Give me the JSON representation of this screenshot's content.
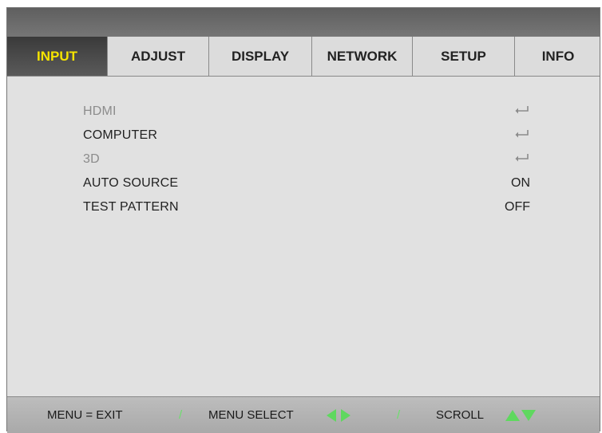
{
  "tabs": [
    {
      "label": "INPUT",
      "active": true
    },
    {
      "label": "ADJUST",
      "active": false
    },
    {
      "label": "DISPLAY",
      "active": false
    },
    {
      "label": "NETWORK",
      "active": false
    },
    {
      "label": "SETUP",
      "active": false
    },
    {
      "label": "INFO",
      "active": false
    }
  ],
  "menu": {
    "items": [
      {
        "label": "HDMI",
        "value_icon": "enter-icon",
        "enabled": false
      },
      {
        "label": "COMPUTER",
        "value_icon": "enter-icon",
        "enabled": true
      },
      {
        "label": "3D",
        "value_icon": "enter-icon",
        "enabled": false
      },
      {
        "label": "AUTO SOURCE",
        "value": "ON",
        "enabled": true
      },
      {
        "label": "TEST PATTERN",
        "value": "OFF",
        "enabled": true
      }
    ]
  },
  "footer": {
    "exit": "MENU = EXIT",
    "separator": "/",
    "select": "MENU SELECT",
    "scroll": "SCROLL"
  },
  "colors": {
    "active_tab_text": "#f5e400",
    "arrow_green": "#5fd85f",
    "disabled_text": "#8c8c8c"
  }
}
